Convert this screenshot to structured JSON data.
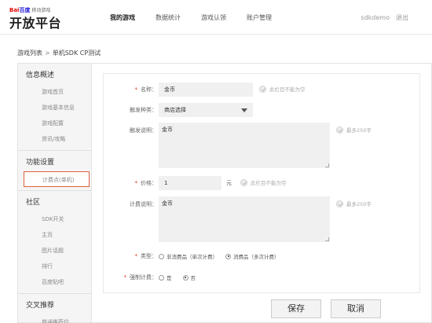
{
  "brand": {
    "logo_bai": "Bai",
    "logo_du": "百度",
    "logo_sub": "移动游戏",
    "title": "开放平台"
  },
  "nav": {
    "items": [
      "我的游戏",
      "数据统计",
      "游戏认领",
      "账户管理"
    ]
  },
  "user": {
    "name": "sdkdemo",
    "logout": "退出"
  },
  "breadcrumb": {
    "root": "游戏列表",
    "sep": ">",
    "current": "单机SDK CP测试"
  },
  "sidebar": {
    "section1": "信息概述",
    "s1_items": [
      "游戏首页",
      "游戏基本信息",
      "游戏配置",
      "资讯/攻略"
    ],
    "section2": "功能设置",
    "s2_items": [
      "计费点(单机)"
    ],
    "section3": "社区",
    "s3_items": [
      "SDK开关",
      "主页",
      "图片话题",
      "排行",
      "百度贴吧"
    ],
    "section4": "交叉推荐",
    "s4_items": [
      "普通推荐位"
    ]
  },
  "form": {
    "name_label": "名称：",
    "name_value": "金币",
    "name_hint": "此栏目不能为空",
    "trigger_type_label": "触发种类：",
    "trigger_type_value": "商店选择",
    "trigger_desc_label": "触发说明：",
    "trigger_desc_value": "金币",
    "trigger_desc_hint": "最多250字",
    "price_label": "价格：",
    "price_value": "1",
    "price_unit": "元",
    "price_hint": "此栏目不能为空",
    "billing_desc_label": "计费说明：",
    "billing_desc_value": "金币",
    "billing_desc_hint": "最多250字",
    "type_label": "类型：",
    "type_options": [
      "非消费品（单次计费）",
      "消费品（多次计费）"
    ],
    "force_label": "强制计费：",
    "force_options": [
      "是",
      "否"
    ]
  },
  "actions": {
    "save": "保存",
    "cancel": "取消"
  }
}
